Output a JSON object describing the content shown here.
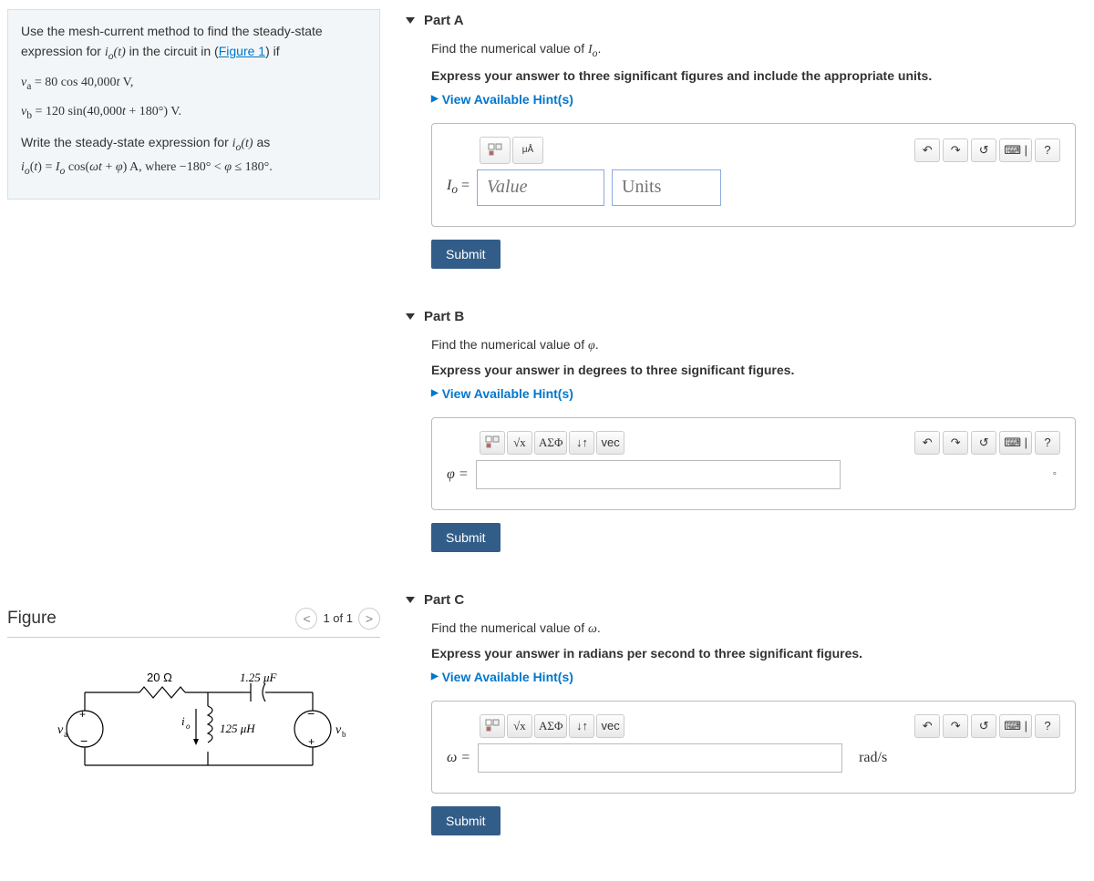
{
  "problem": {
    "line1_a": "Use the mesh-current method to find the steady-state expression for ",
    "line1_b": " in the circuit in (",
    "figureLinkText": "Figure 1",
    "line1_c": ") if",
    "eq1": "v_a = 80 cos 40,000t V,",
    "eq2": "v_b = 120 sin(40,000t + 180°) V.",
    "line3_a": "Write the steady-state expression for ",
    "line3_b": " as",
    "eq3": "i_o(t) = I_o cos(ωt + φ) A, where −180° < φ ≤ 180°."
  },
  "figure": {
    "title": "Figure",
    "navText": "1 of 1",
    "labels": {
      "r": "20 Ω",
      "c": "1.25 μF",
      "l": "125 μH",
      "io": "i_o",
      "va": "v_a",
      "vb": "v_b"
    }
  },
  "partA": {
    "title": "Part A",
    "q": "Find the numerical value of I_o.",
    "instr": "Express your answer to three significant figures and include the appropriate units.",
    "hints": "View Available Hint(s)",
    "label": "I_o =",
    "valuePlaceholder": "Value",
    "unitsPlaceholder": "Units",
    "submit": "Submit"
  },
  "partB": {
    "title": "Part B",
    "q": "Find the numerical value of φ.",
    "instr": "Express your answer in degrees to three significant figures.",
    "hints": "View Available Hint(s)",
    "label": "φ =",
    "submit": "Submit",
    "degMark": "°"
  },
  "partC": {
    "title": "Part C",
    "q": "Find the numerical value of ω.",
    "instr": "Express your answer in radians per second to three significant figures.",
    "hints": "View Available Hint(s)",
    "label": "ω =",
    "unitSuffix": "rad/s",
    "submit": "Submit"
  },
  "tools": {
    "greek": "ΑΣΦ",
    "vec": "vec",
    "help": "?",
    "muA": "μÅ"
  }
}
